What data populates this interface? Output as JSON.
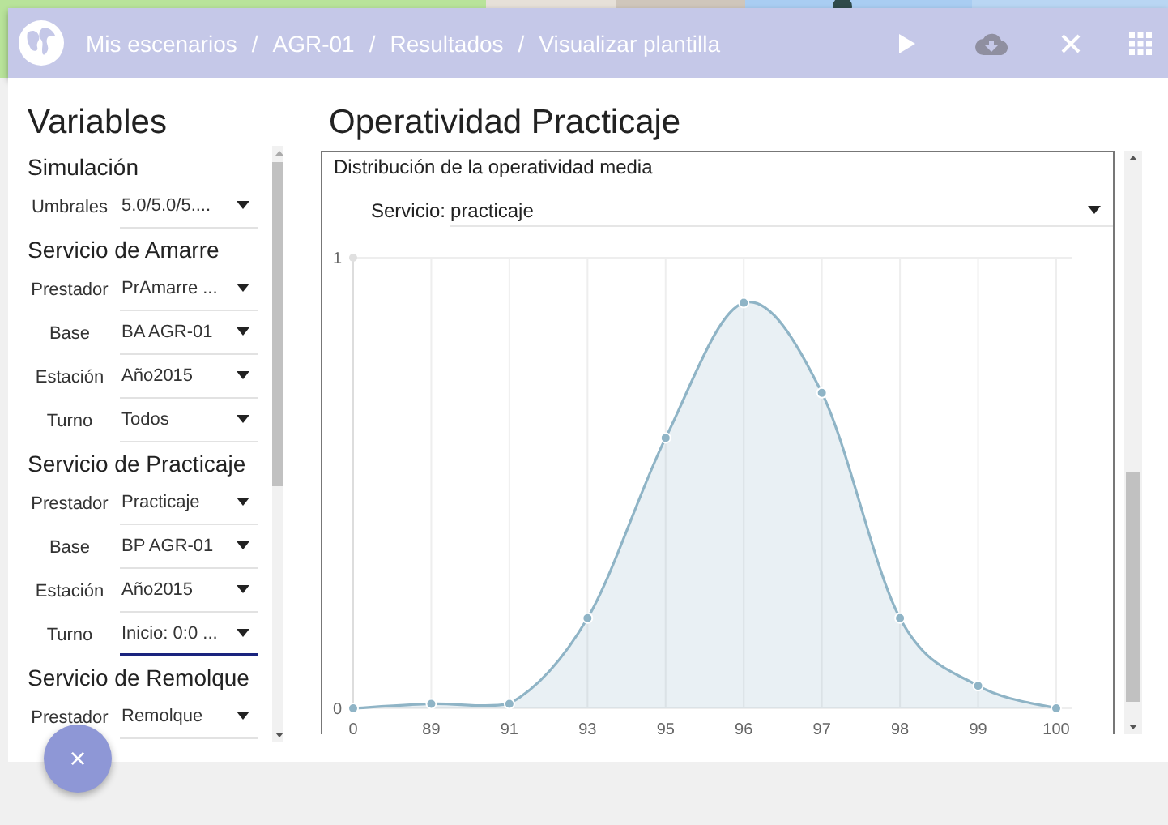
{
  "header": {
    "breadcrumb": [
      {
        "label": "Mis escenarios"
      },
      {
        "separator": "/",
        "label": "AGR-01"
      },
      {
        "separator": "/",
        "label": "Resultados"
      },
      {
        "separator": "/",
        "label": "Visualizar plantilla"
      }
    ]
  },
  "variables": {
    "title": "Variables",
    "items": [
      {
        "kind": "section",
        "label": "Simulación"
      },
      {
        "kind": "select",
        "label": "Umbrales",
        "value": "5.0/5.0/5....",
        "focused": false
      },
      {
        "kind": "section",
        "label": "Servicio de Amarre"
      },
      {
        "kind": "select",
        "label": "Prestador",
        "value": "PrAmarre ...",
        "focused": false
      },
      {
        "kind": "select",
        "label": "Base",
        "value": "BA AGR-01",
        "focused": false
      },
      {
        "kind": "select",
        "label": "Estación",
        "value": "Año2015",
        "focused": false
      },
      {
        "kind": "select",
        "label": "Turno",
        "value": "Todos",
        "focused": false
      },
      {
        "kind": "section",
        "label": "Servicio de Practicaje"
      },
      {
        "kind": "select",
        "label": "Prestador",
        "value": "Practicaje",
        "focused": false
      },
      {
        "kind": "select",
        "label": "Base",
        "value": "BP AGR-01",
        "focused": false
      },
      {
        "kind": "select",
        "label": "Estación",
        "value": "Año2015",
        "focused": false
      },
      {
        "kind": "select",
        "label": "Turno",
        "value": "Inicio: 0:0 ...",
        "focused": true
      },
      {
        "kind": "section",
        "label": "Servicio de Remolque"
      },
      {
        "kind": "select",
        "label": "Prestador",
        "value": "Remolque",
        "focused": false
      }
    ]
  },
  "results": {
    "title": "Operatividad Practicaje",
    "panel": {
      "title": "Distribución de la operatividad media",
      "filter": {
        "label": "Servicio:",
        "value": "practicaje"
      },
      "chart_data": {
        "type": "area",
        "categories": [
          "0",
          "89",
          "91",
          "93",
          "95",
          "96",
          "97",
          "98",
          "99",
          "100"
        ],
        "series": [
          {
            "color": "#8fb4c6",
            "values": [
              0,
              0.01,
              0.01,
              0.2,
              0.6,
              0.9,
              0.7,
              0.2,
              0.05,
              0
            ]
          }
        ],
        "ylim": [
          0,
          1
        ],
        "yticks": [
          0,
          1
        ],
        "grid": true
      }
    }
  },
  "fab": {
    "label": "×"
  }
}
